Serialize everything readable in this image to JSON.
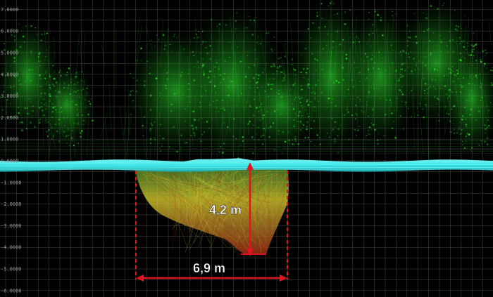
{
  "viewer": {
    "grid_color": "#4a4a4a",
    "background_color": "#000000",
    "vegetation_color": "#1fd11f",
    "water_color": "#27e3e6",
    "measure_color": "#e0141c",
    "sinkhole_colors": [
      "#9ec83a",
      "#e2d630",
      "#c89a2a",
      "#9b2a12"
    ]
  },
  "axis": {
    "ticks": [
      {
        "value": 7,
        "label": "7.0000"
      },
      {
        "value": 6,
        "label": "6.0000"
      },
      {
        "value": 5,
        "label": "5.0000"
      },
      {
        "value": 4,
        "label": "4.0000"
      },
      {
        "value": 3,
        "label": "3.0000"
      },
      {
        "value": 2,
        "label": "2.0000"
      },
      {
        "value": 1,
        "label": "1.0000"
      },
      {
        "value": 0,
        "label": "0.0000"
      },
      {
        "value": -1,
        "label": "-1.0000"
      },
      {
        "value": -2,
        "label": "-2.0000"
      },
      {
        "value": -3,
        "label": "-3.0000"
      },
      {
        "value": -4,
        "label": "-4.0000"
      },
      {
        "value": -5,
        "label": "-5.0000"
      },
      {
        "value": -6,
        "label": "-6.0000"
      }
    ]
  },
  "measurements": {
    "depth": {
      "label": "4,2 m",
      "value_m": 4.2
    },
    "width": {
      "label": "6,9 m",
      "value_m": 6.9
    }
  }
}
